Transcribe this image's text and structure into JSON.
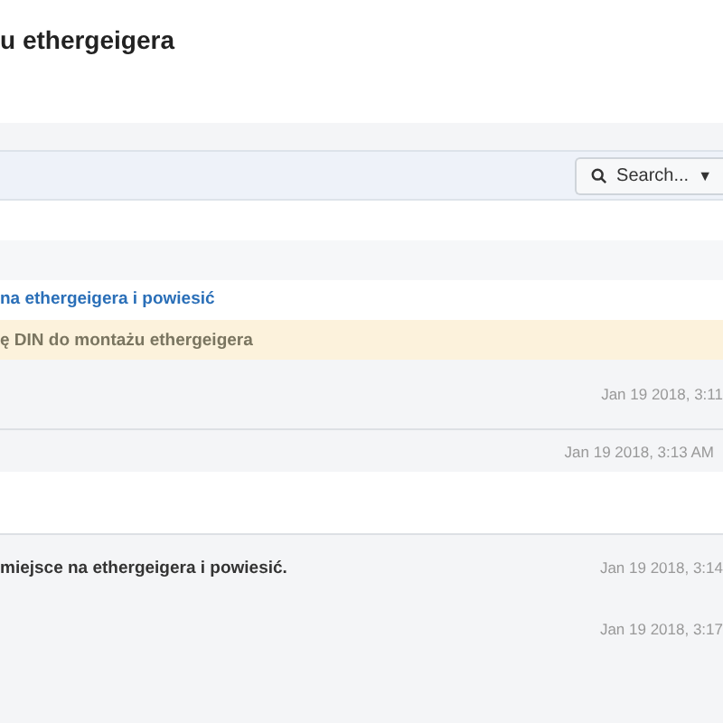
{
  "page_title": "u ethergeigera",
  "toolbar": {
    "search_button": "Search...",
    "caret": "▼"
  },
  "entries": [
    {
      "kind": "link",
      "text": "na ethergeigera i powiesić"
    },
    {
      "kind": "notice",
      "text": "ę DIN do montażu ethergeigera"
    }
  ],
  "messages_top": [
    {
      "time": "Jan 19 2018, 3:11"
    },
    {
      "time": "Jan 19 2018, 3:13 AM"
    }
  ],
  "messages_bottom": [
    {
      "text": "miejsce na ethergeigera i powiesić.",
      "time": "Jan 19 2018, 3:14"
    },
    {
      "time": "Jan 19 2018, 3:17"
    }
  ]
}
